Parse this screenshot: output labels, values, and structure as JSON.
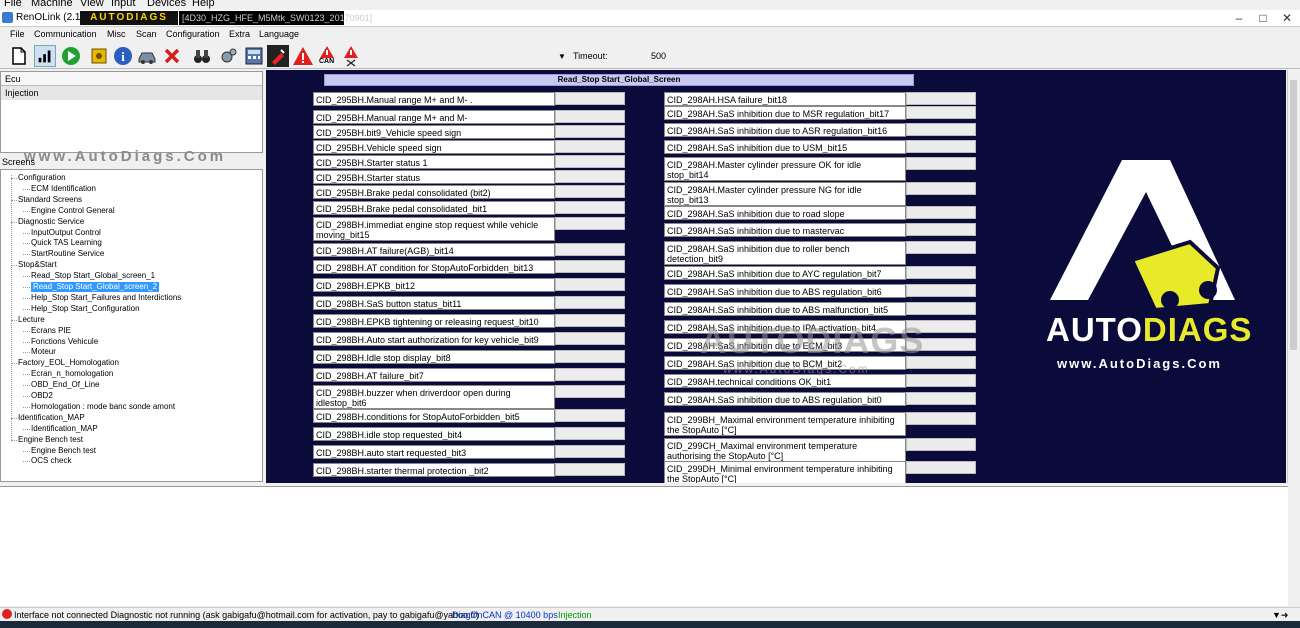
{
  "host_menu": [
    "File",
    "Machine",
    "View",
    "Input",
    "Devices",
    "Help"
  ],
  "title": {
    "app": "RenOLink (2.11)",
    "brand": "AUTODIAGS",
    "document": "[4D30_HZG_HFE_M5Mtk_SW0123_20170901]"
  },
  "menu": [
    "File",
    "Communication",
    "Misc",
    "Scan",
    "Configuration",
    "Extra",
    "Language"
  ],
  "toolbar": {
    "can_label": "CAN",
    "timeout_label": "Timeout:",
    "timeout_value": "500"
  },
  "ecu": {
    "header": "Ecu",
    "selected": "Injection"
  },
  "screens_label": "Screens",
  "watermark": "www.AutoDiags.Com",
  "tree": [
    {
      "label": "Configuration",
      "level": 0
    },
    {
      "label": "ECM Identification",
      "level": 1
    },
    {
      "label": "Standard Screens",
      "level": 0
    },
    {
      "label": "Engine Control General",
      "level": 1
    },
    {
      "label": "Diagnostic Service",
      "level": 0
    },
    {
      "label": "InputOutput Control",
      "level": 1
    },
    {
      "label": "Quick TAS Learning",
      "level": 1
    },
    {
      "label": "StartRoutine Service",
      "level": 1
    },
    {
      "label": "Stop&Start",
      "level": 0
    },
    {
      "label": "Read_Stop Start_Global_screen_1",
      "level": 1
    },
    {
      "label": "Read_Stop Start_Global_screen_2",
      "level": 1,
      "selected": true
    },
    {
      "label": "Help_Stop Start_Failures and Interdictions",
      "level": 1
    },
    {
      "label": "Help_Stop Start_Configuration",
      "level": 1
    },
    {
      "label": "Lecture",
      "level": 0
    },
    {
      "label": "Ecrans PIE",
      "level": 1
    },
    {
      "label": "Fonctions Vehicule",
      "level": 1
    },
    {
      "label": "Moteur",
      "level": 1
    },
    {
      "label": "Factory_EOL_Homologation",
      "level": 0
    },
    {
      "label": "Ecran_n_homologation",
      "level": 1
    },
    {
      "label": "OBD_End_Of_Line",
      "level": 1
    },
    {
      "label": "OBD2",
      "level": 1
    },
    {
      "label": "Homologation : mode banc sonde amont",
      "level": 1
    },
    {
      "label": "Identification_MAP",
      "level": 0
    },
    {
      "label": "Identification_MAP",
      "level": 1
    },
    {
      "label": "Engine Bench test",
      "level": 0
    },
    {
      "label": "Engine Bench test",
      "level": 1
    },
    {
      "label": "OCS check",
      "level": 1
    }
  ],
  "screen_title": "Read_Stop Start_Global_Screen",
  "left_params": [
    "CID_295BH.Manual range M+ and M- .",
    "CID_295BH.Manual range M+ and M-",
    "CID_295BH.bit9_Vehicle speed sign",
    "CID_295BH.Vehicle speed sign",
    "CID_295BH.Starter status 1",
    "CID_295BH.Starter status",
    "CID_295BH.Brake pedal consolidated (bit2)",
    "CID_295BH.Brake pedal consolidated_bit1",
    "CID_298BH.immediat engine stop request while vehicle moving_bit15",
    "CID_298BH.AT failure(AGB)_bit14",
    "CID_298BH.AT condition for StopAutoForbidden_bit13",
    "CID_298BH.EPKB_bit12",
    "CID_298BH.SaS button status_bit11",
    "CID_298BH.EPKB tightening or releasing request_bit10",
    "CID_298BH.Auto start authorization for key vehicle_bit9",
    "CID_298BH.Idle stop display_bit8",
    "CID_298BH.AT failure_bit7",
    "CID_298BH.buzzer when driverdoor open during idlestop_bit6",
    "CID_298BH.conditions for StopAutoForbidden_bit5",
    "CID_298BH.idle stop requested_bit4",
    "CID_298BH.auto start requested_bit3",
    "CID_298BH.starter thermal protection _bit2"
  ],
  "right_params": [
    "CID_298AH.HSA failure_bit18",
    "CID_298AH.SaS inhibition due to MSR regulation_bit17",
    "CID_298AH.SaS inhibition due to ASR regulation_bit16",
    "CID_298AH.SaS inhibition due to USM_bit15",
    "CID_298AH.Master cylinder pressure OK for idle stop_bit14",
    "CID_298AH.Master cylinder pressure NG for idle stop_bit13",
    "CID_298AH.SaS inhibition due to road slope",
    "CID_298AH.SaS inhibition due to mastervac",
    "CID_298AH.SaS inhibition due to roller bench detection_bit9",
    "CID_298AH.SaS inhibition due to AYC regulation_bit7",
    "CID_298AH.SaS inhibition due to ABS regulation_bit6",
    "CID_298AH.SaS inhibition due to ABS malfunction_bit5",
    "CID_298AH.SaS inhibition due to IPA activation_bit4",
    "CID_298AH.SaS inhibition due to ECM_bit3",
    "CID_298AH.SaS inhibition due to BCM_bit2",
    "CID_298AH.technical conditions OK_bit1",
    "CID_298AH.SaS inhibition due to ABS regulation_bit0",
    "CID_299BH_Maximal environment temperature inhibiting the StopAuto [°C]",
    "CID_299CH_Maximal environment temperature authorising the StopAuto [°C]",
    "CID_299DH_Minimal environment temperature inhibiting the StopAuto [°C]"
  ],
  "center_watermark": {
    "text": "AUTODIAGS",
    "url": "www.AutoDiags.Com"
  },
  "logo": {
    "text_a": "AUTO",
    "text_b": "DIAGS",
    "url": "www.AutoDiags.Com",
    "accent": "#e8ea29"
  },
  "status": {
    "main": "Interface not connected Diagnostic not running (ask gabigafu@hotmail.com for activation, pay to gabigafu@yahoo.fr)",
    "bus": "DiagOnCAN @ 10400 bps",
    "ecu": "Injection"
  }
}
